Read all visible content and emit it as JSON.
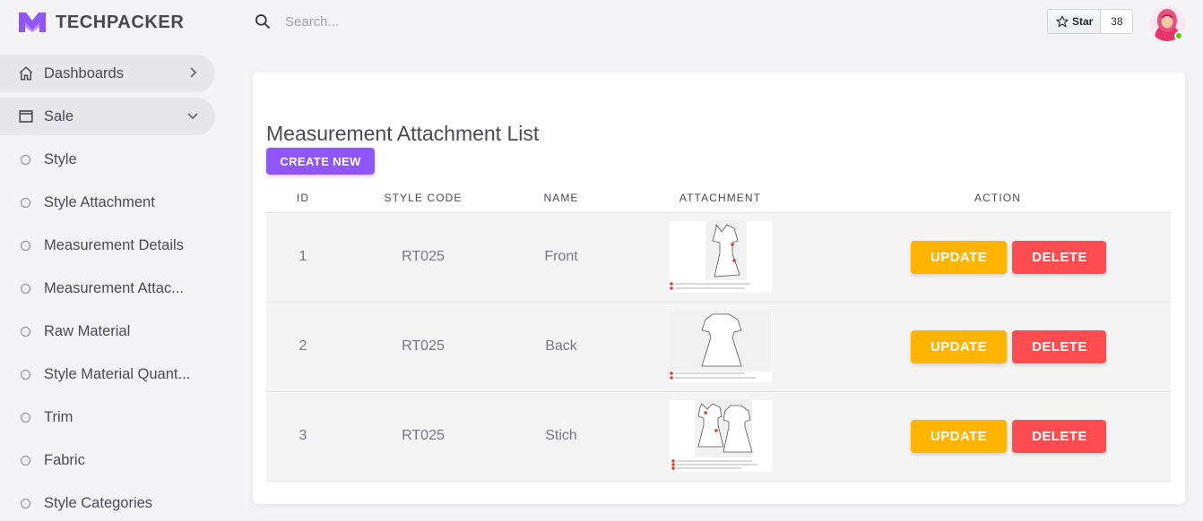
{
  "brand": {
    "name": "TECHPACKER",
    "color": "#9155fd"
  },
  "search": {
    "placeholder": "Search...",
    "value": ""
  },
  "github": {
    "star_label": "Star",
    "count": "38"
  },
  "sidebar": {
    "items": [
      {
        "label": "Dashboards",
        "icon": "home-icon",
        "trailing": "chevron-right-icon",
        "active": true
      },
      {
        "label": "Sale",
        "icon": "window-icon",
        "trailing": "chevron-down-icon",
        "active": true
      },
      {
        "label": "Style",
        "icon": "circle-icon"
      },
      {
        "label": "Style Attachment",
        "icon": "circle-icon"
      },
      {
        "label": "Measurement Details",
        "icon": "circle-icon"
      },
      {
        "label": "Measurement Attac...",
        "icon": "circle-icon"
      },
      {
        "label": "Raw Material",
        "icon": "circle-icon"
      },
      {
        "label": "Style Material Quant...",
        "icon": "circle-icon"
      },
      {
        "label": "Trim",
        "icon": "circle-icon"
      },
      {
        "label": "Fabric",
        "icon": "circle-icon"
      },
      {
        "label": "Style Categories",
        "icon": "circle-icon"
      }
    ]
  },
  "main": {
    "title": "Measurement Attachment List",
    "create_label": "CREATE NEW",
    "columns": [
      "ID",
      "STYLE CODE",
      "NAME",
      "ATTACHMENT",
      "ACTION"
    ],
    "rows": [
      {
        "id": "1",
        "style_code": "RT025",
        "name": "Front",
        "attachment": "front-sketch-image"
      },
      {
        "id": "2",
        "style_code": "RT025",
        "name": "Back",
        "attachment": "back-sketch-image"
      },
      {
        "id": "3",
        "style_code": "RT025",
        "name": "Stich",
        "attachment": "stitch-sketch-image"
      }
    ],
    "update_label": "UPDATE",
    "delete_label": "DELETE"
  },
  "colors": {
    "primary": "#9155fd",
    "update": "#ffb400",
    "delete": "#ff4c51",
    "online": "#56ca00"
  }
}
